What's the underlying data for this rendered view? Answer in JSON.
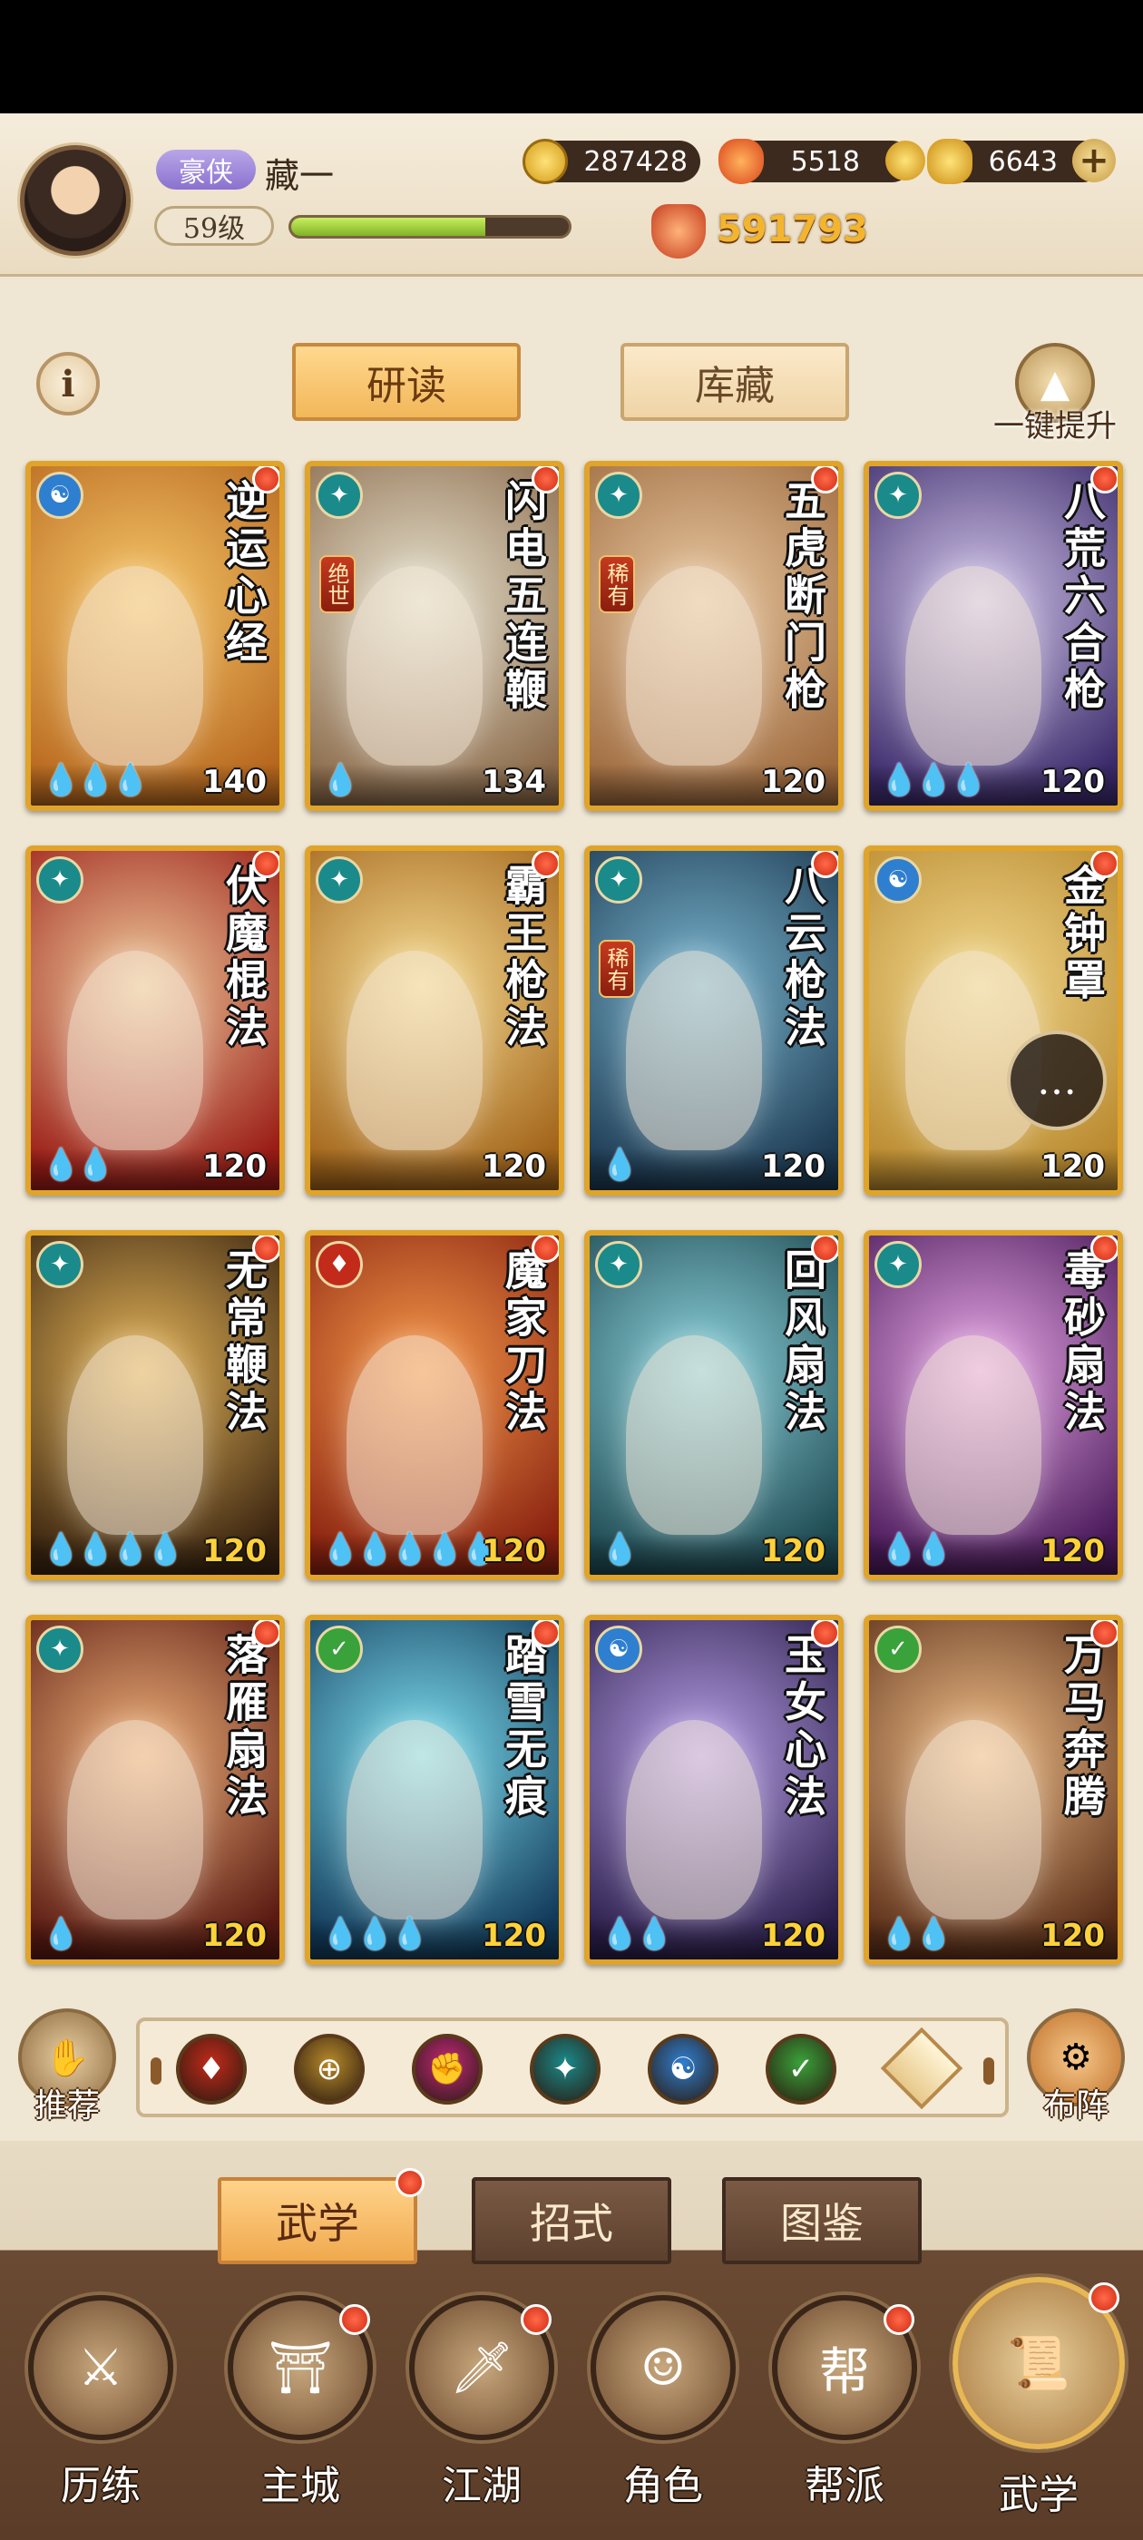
{
  "player": {
    "title": "豪侠",
    "name": "藏一",
    "level": "59级",
    "xp_fraction": 0.7,
    "power": "591793"
  },
  "currencies": {
    "coins": "287428",
    "flames": "5518",
    "ingots": "6643"
  },
  "tabs": {
    "study": "研读",
    "storage": "库藏",
    "one_key_upgrade": "一键提升"
  },
  "cards": [
    {
      "name": "逆运心经",
      "level": "140",
      "drops": "💧💧💧",
      "school": "☯",
      "school_color": "#2f7fd0",
      "art": [
        "#f7c86a",
        "#b7671e"
      ],
      "rarity": "",
      "gold_level": false
    },
    {
      "name": "闪电五连鞭",
      "level": "134",
      "drops": "💧",
      "school": "✦",
      "school_color": "#1a8a8a",
      "art": [
        "#e7e3d0",
        "#8b6a4a"
      ],
      "rarity": "绝世",
      "gold_level": false
    },
    {
      "name": "五虎断门枪",
      "level": "120",
      "drops": "",
      "school": "✦",
      "school_color": "#1a8a8a",
      "art": [
        "#e9c9a2",
        "#9e6a3e"
      ],
      "rarity": "稀有",
      "gold_level": false
    },
    {
      "name": "八荒六合枪",
      "level": "120",
      "drops": "💧💧💧",
      "school": "✦",
      "school_color": "#1a8a8a",
      "art": [
        "#d3c6ea",
        "#3b2a6a"
      ],
      "rarity": "",
      "gold_level": false
    },
    {
      "name": "伏魔棍法",
      "level": "120",
      "drops": "💧💧",
      "school": "✦",
      "school_color": "#1a8a8a",
      "art": [
        "#f0cc9c",
        "#9a1c16"
      ],
      "rarity": "",
      "gold_level": false
    },
    {
      "name": "霸王枪法",
      "level": "120",
      "drops": "",
      "school": "✦",
      "school_color": "#1a8a8a",
      "art": [
        "#f6dc92",
        "#a2641a"
      ],
      "rarity": "",
      "gold_level": false
    },
    {
      "name": "八云枪法",
      "level": "120",
      "drops": "💧",
      "school": "✦",
      "school_color": "#1a8a8a",
      "art": [
        "#7ab6cf",
        "#1d3a52"
      ],
      "rarity": "稀有",
      "gold_level": false
    },
    {
      "name": "金钟罩",
      "level": "120",
      "drops": "",
      "school": "☯",
      "school_color": "#2f7fd0",
      "art": [
        "#f2d98e",
        "#b9892e"
      ],
      "rarity": "",
      "gold_level": false
    },
    {
      "name": "无常鞭法",
      "level": "120",
      "drops": "💧💧💧💧",
      "school": "✦",
      "school_color": "#1a8a8a",
      "art": [
        "#e6b659",
        "#3a2410"
      ],
      "rarity": "",
      "gold_level": true
    },
    {
      "name": "魔家刀法",
      "level": "120",
      "drops": "💧💧💧💧💧",
      "school": "♦",
      "school_color": "#c22a1a",
      "art": [
        "#f79a4a",
        "#8a2210"
      ],
      "rarity": "",
      "gold_level": true
    },
    {
      "name": "回风扇法",
      "level": "120",
      "drops": "💧",
      "school": "✦",
      "school_color": "#1a8a8a",
      "art": [
        "#8cd2dc",
        "#1f4a52"
      ],
      "rarity": "",
      "gold_level": true
    },
    {
      "name": "毒砂扇法",
      "level": "120",
      "drops": "💧💧",
      "school": "✦",
      "school_color": "#1a8a8a",
      "art": [
        "#e9a9e7",
        "#4a1a5a"
      ],
      "rarity": "",
      "gold_level": true
    },
    {
      "name": "落雁扇法",
      "level": "120",
      "drops": "💧",
      "school": "✦",
      "school_color": "#1a8a8a",
      "art": [
        "#f0b27a",
        "#5a1a12"
      ],
      "rarity": "",
      "gold_level": true
    },
    {
      "name": "踏雪无痕",
      "level": "120",
      "drops": "💧💧💧",
      "school": "✓",
      "school_color": "#3aa23a",
      "art": [
        "#7ee0f0",
        "#123a5a"
      ],
      "rarity": "",
      "gold_level": true
    },
    {
      "name": "玉女心法",
      "level": "120",
      "drops": "💧💧",
      "school": "☯",
      "school_color": "#2f7fd0",
      "art": [
        "#b9a0e8",
        "#2a1e4a"
      ],
      "rarity": "",
      "gold_level": true
    },
    {
      "name": "万马奔腾",
      "level": "120",
      "drops": "💧💧",
      "school": "✓",
      "school_color": "#3aa23a",
      "art": [
        "#f2c18a",
        "#5a2e18"
      ],
      "rarity": "",
      "gold_level": true
    }
  ],
  "filter": {
    "recommend": "推荐",
    "formation": "布阵",
    "icons": [
      {
        "symbol": "♦",
        "color": "#c22a1a"
      },
      {
        "symbol": "⊕",
        "color": "#b88a2a"
      },
      {
        "symbol": "✊",
        "color": "#c2287a"
      },
      {
        "symbol": "✦",
        "color": "#1a8a8a"
      },
      {
        "symbol": "☯",
        "color": "#2f7fd0"
      },
      {
        "symbol": "✓",
        "color": "#3aa23a"
      }
    ]
  },
  "subtabs": {
    "martial": "武学",
    "moves": "招式",
    "atlas": "图鉴"
  },
  "nav": {
    "training": "历练",
    "main_city": "主城",
    "jianghu": "江湖",
    "character": "角色",
    "guild": "帮派",
    "martial": "武学"
  }
}
